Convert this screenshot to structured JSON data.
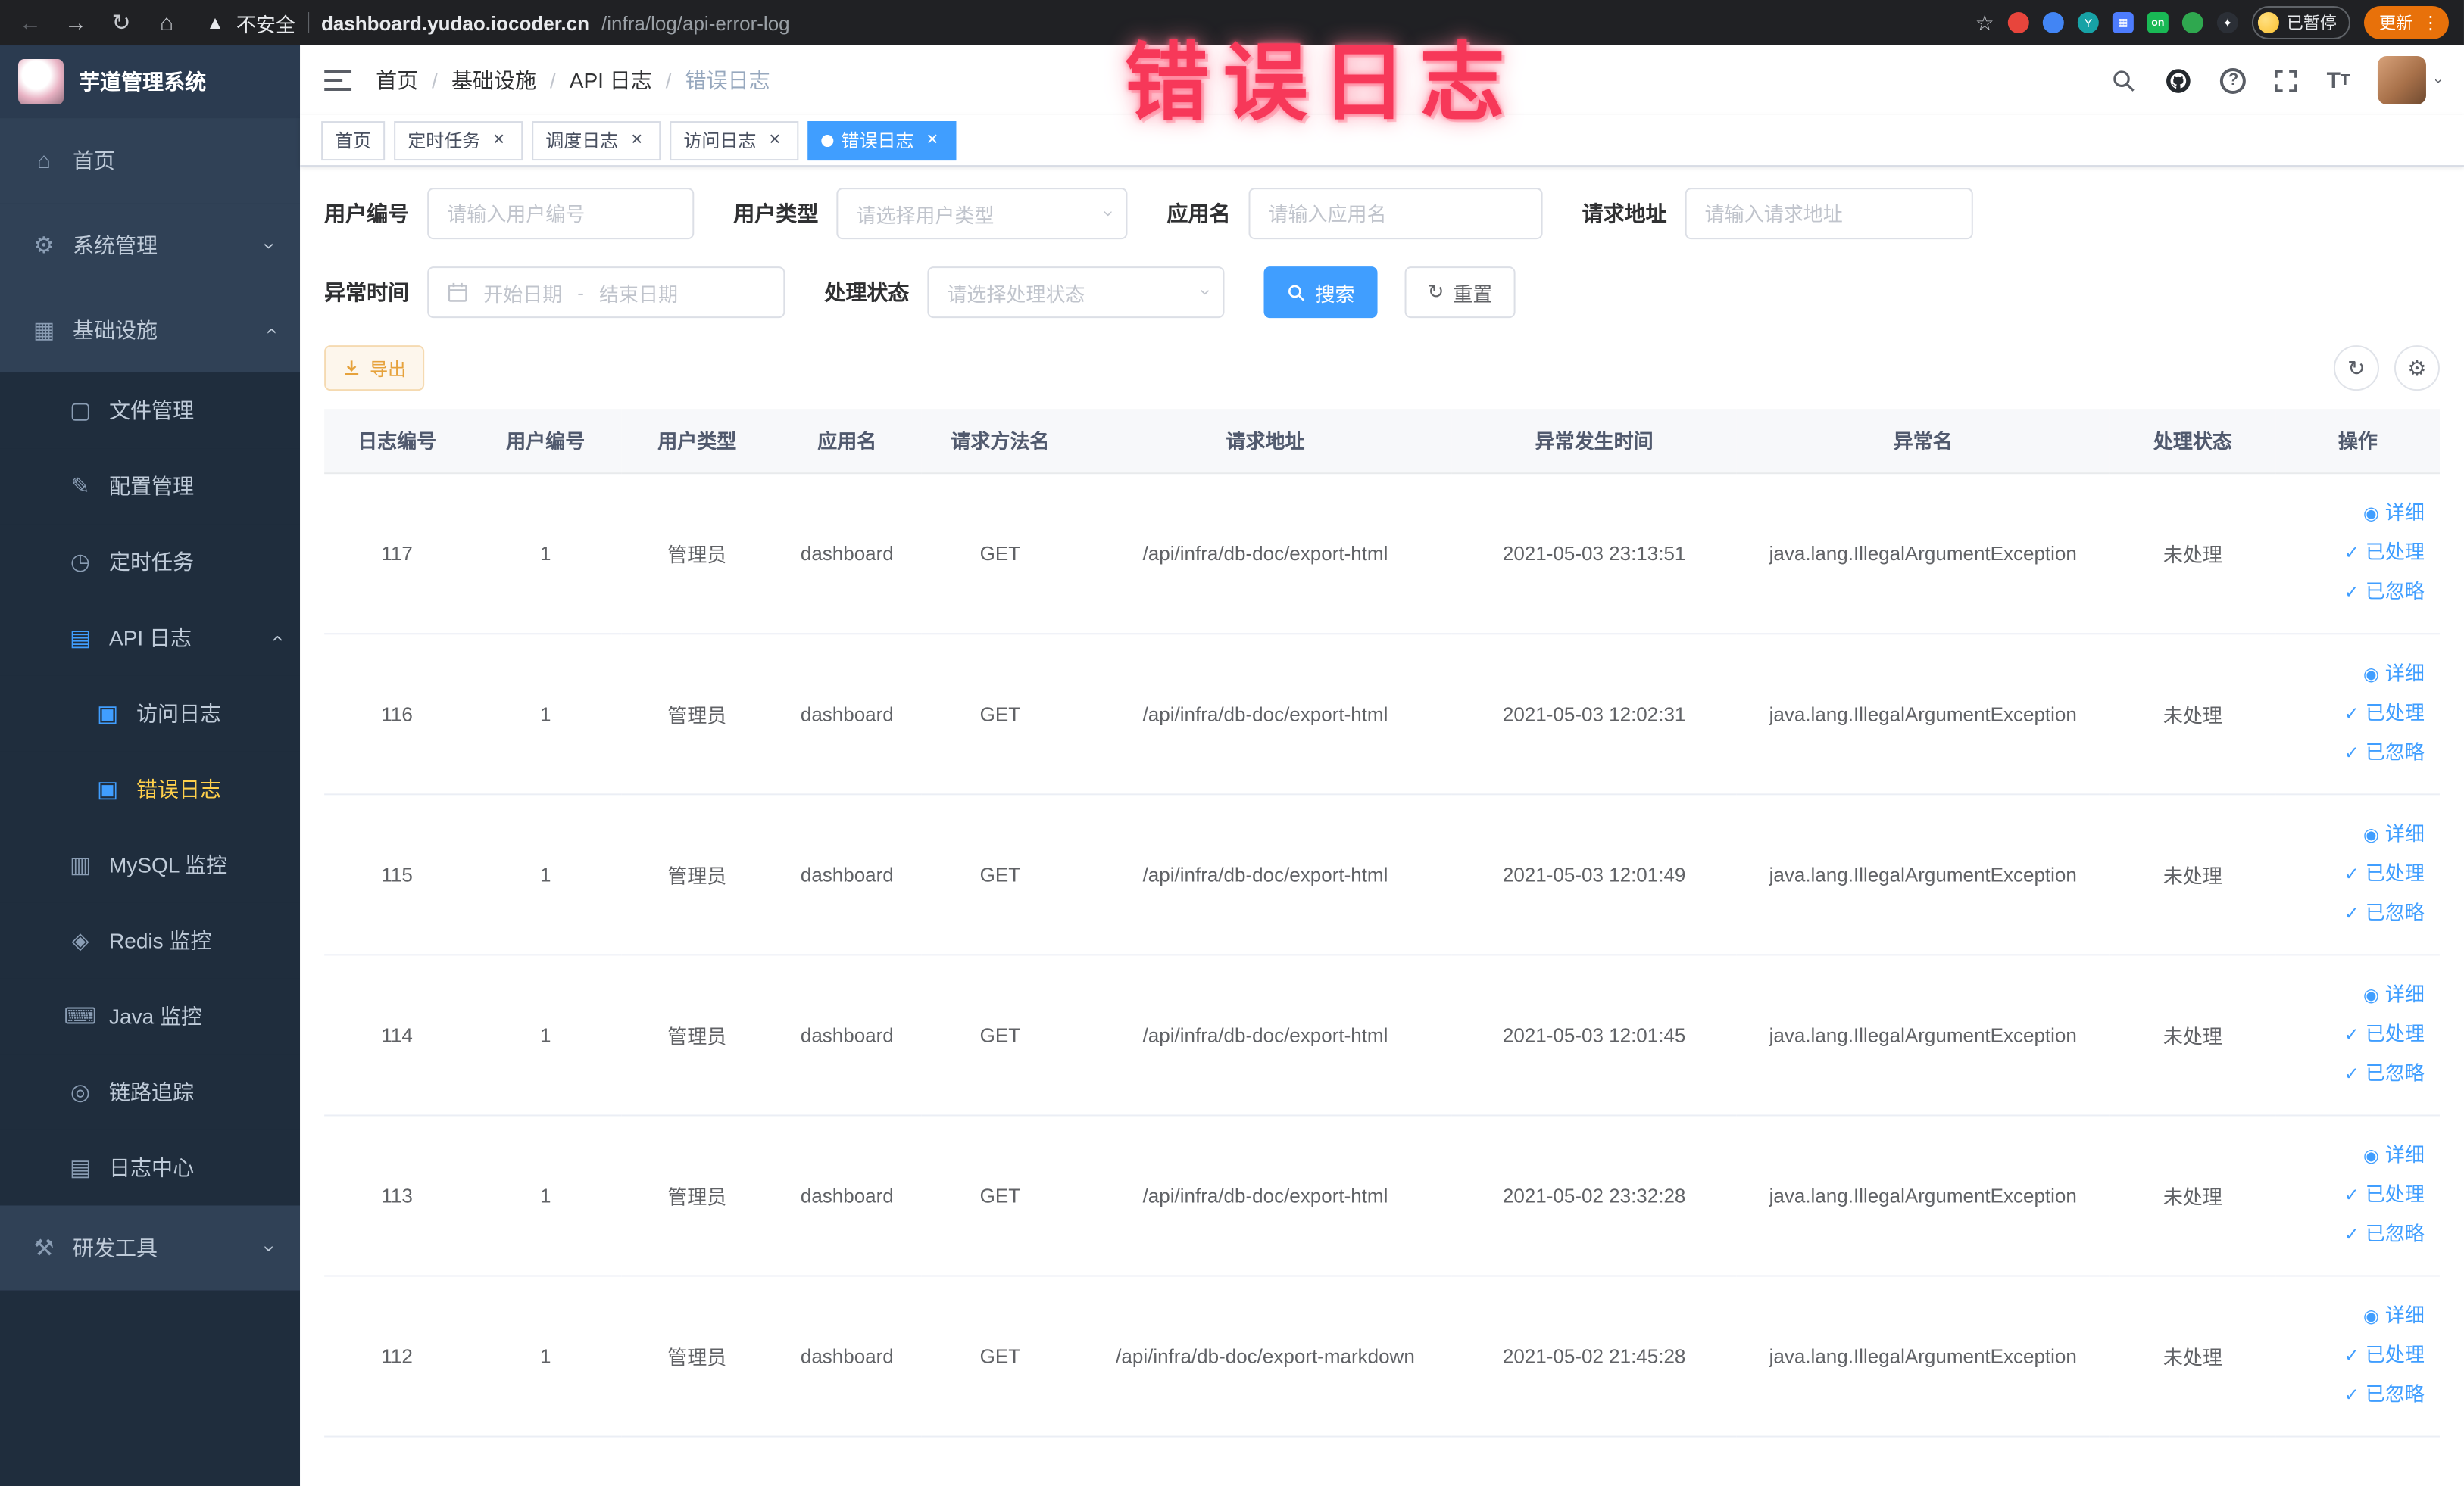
{
  "browser": {
    "security_label": "不安全",
    "url_host": "dashboard.yudao.iocoder.cn",
    "url_path": "/infra/log/api-error-log",
    "paused_badge": "已暂停",
    "update_button": "更新",
    "extension_on_badge": "on"
  },
  "annotation": {
    "text": "错误日志"
  },
  "sidebar": {
    "app_title": "芋道管理系统",
    "items": [
      {
        "key": "home",
        "label": "首页",
        "icon": "home-icon",
        "level": 1
      },
      {
        "key": "system",
        "label": "系统管理",
        "icon": "gear-icon",
        "level": 1,
        "arrow": "down"
      },
      {
        "key": "infra",
        "label": "基础设施",
        "icon": "infra-icon",
        "level": 1,
        "arrow": "up"
      },
      {
        "key": "file",
        "label": "文件管理",
        "icon": "file-icon",
        "level": 2
      },
      {
        "key": "config",
        "label": "配置管理",
        "icon": "config-icon",
        "level": 2
      },
      {
        "key": "job",
        "label": "定时任务",
        "icon": "task-icon",
        "level": 2
      },
      {
        "key": "api-log",
        "label": "API 日志",
        "icon": "api-icon",
        "level": 2,
        "arrow": "up",
        "blue": true
      },
      {
        "key": "access-log",
        "label": "访问日志",
        "icon": "log-icon",
        "level": 3
      },
      {
        "key": "error-log",
        "label": "错误日志",
        "icon": "log-icon",
        "level": 3,
        "active": true
      },
      {
        "key": "mysql",
        "label": "MySQL 监控",
        "icon": "mysql-icon",
        "level": 2
      },
      {
        "key": "redis",
        "label": "Redis 监控",
        "icon": "redis-icon",
        "level": 2
      },
      {
        "key": "java",
        "label": "Java 监控",
        "icon": "java-icon",
        "level": 2
      },
      {
        "key": "trace",
        "label": "链路追踪",
        "icon": "trace-icon",
        "level": 2
      },
      {
        "key": "log-center",
        "label": "日志中心",
        "icon": "center-icon",
        "level": 2
      },
      {
        "key": "dev-tools",
        "label": "研发工具",
        "icon": "tools-icon",
        "level": 1,
        "arrow": "down"
      }
    ]
  },
  "header": {
    "breadcrumb": [
      "首页",
      "基础设施",
      "API 日志",
      "错误日志"
    ]
  },
  "tabs": [
    {
      "label": "首页",
      "closable": false,
      "active": false
    },
    {
      "label": "定时任务",
      "closable": true,
      "active": false
    },
    {
      "label": "调度日志",
      "closable": true,
      "active": false
    },
    {
      "label": "访问日志",
      "closable": true,
      "active": false
    },
    {
      "label": "错误日志",
      "closable": true,
      "active": true
    }
  ],
  "filters": {
    "user_id": {
      "label": "用户编号",
      "placeholder": "请输入用户编号"
    },
    "user_type": {
      "label": "用户类型",
      "placeholder": "请选择用户类型"
    },
    "app_name": {
      "label": "应用名",
      "placeholder": "请输入应用名"
    },
    "request_url": {
      "label": "请求地址",
      "placeholder": "请输入请求地址"
    },
    "exception_time": {
      "label": "异常时间",
      "start_placeholder": "开始日期",
      "separator": "-",
      "end_placeholder": "结束日期"
    },
    "process_status": {
      "label": "处理状态",
      "placeholder": "请选择处理状态"
    },
    "search_button": "搜索",
    "reset_button": "重置"
  },
  "toolbar": {
    "export_button": "导出"
  },
  "table": {
    "columns": [
      "日志编号",
      "用户编号",
      "用户类型",
      "应用名",
      "请求方法名",
      "请求地址",
      "异常发生时间",
      "异常名",
      "处理状态",
      "操作"
    ],
    "column_keys": [
      "log-id",
      "user-id",
      "user-type",
      "app-name",
      "method",
      "request-url",
      "exception-time",
      "exception-name",
      "process-status",
      "operation"
    ],
    "actions": {
      "detail": "详细",
      "processed": "已处理",
      "ignored": "已忽略"
    },
    "rows": [
      {
        "id": "117",
        "user_id": "1",
        "user_type": "管理员",
        "app": "dashboard",
        "method": "GET",
        "url": "/api/infra/db-doc/export-html",
        "time": "2021-05-03 23:13:51",
        "exception": "java.lang.IllegalArgumentException",
        "status": "未处理"
      },
      {
        "id": "116",
        "user_id": "1",
        "user_type": "管理员",
        "app": "dashboard",
        "method": "GET",
        "url": "/api/infra/db-doc/export-html",
        "time": "2021-05-03 12:02:31",
        "exception": "java.lang.IllegalArgumentException",
        "status": "未处理"
      },
      {
        "id": "115",
        "user_id": "1",
        "user_type": "管理员",
        "app": "dashboard",
        "method": "GET",
        "url": "/api/infra/db-doc/export-html",
        "time": "2021-05-03 12:01:49",
        "exception": "java.lang.IllegalArgumentException",
        "status": "未处理"
      },
      {
        "id": "114",
        "user_id": "1",
        "user_type": "管理员",
        "app": "dashboard",
        "method": "GET",
        "url": "/api/infra/db-doc/export-html",
        "time": "2021-05-03 12:01:45",
        "exception": "java.lang.IllegalArgumentException",
        "status": "未处理"
      },
      {
        "id": "113",
        "user_id": "1",
        "user_type": "管理员",
        "app": "dashboard",
        "method": "GET",
        "url": "/api/infra/db-doc/export-html",
        "time": "2021-05-02 23:32:28",
        "exception": "java.lang.IllegalArgumentException",
        "status": "未处理"
      },
      {
        "id": "112",
        "user_id": "1",
        "user_type": "管理员",
        "app": "dashboard",
        "method": "GET",
        "url": "/api/infra/db-doc/export-markdown",
        "time": "2021-05-02 21:45:28",
        "exception": "java.lang.IllegalArgumentException",
        "status": "未处理"
      }
    ]
  }
}
